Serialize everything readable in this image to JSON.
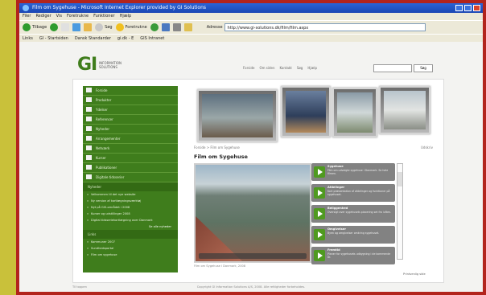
{
  "window": {
    "title": "Film om Sygehuse - Microsoft Internet Explorer provided by GI Solutions"
  },
  "menubar": [
    "Filer",
    "Rediger",
    "Vis",
    "Foretrukne",
    "Funktioner",
    "Hjælp"
  ],
  "toolbar": {
    "back_label": "Tilbage",
    "search_label": "Søg",
    "favorites_label": "Foretrukne",
    "address_label": "Adresse",
    "address_value": "http://www.gi-solutions.dk/film/film.aspx"
  },
  "links": [
    "Links",
    "GI - Startsiden",
    "Dansk Standarder",
    "gi.dk - E",
    "GIS Intranet"
  ],
  "site": {
    "logo_text": "GI",
    "logo_sub": "INFORMATION SOLUTIONS",
    "topnav": [
      "Forside",
      "Om siden",
      "Kontakt",
      "Søg",
      "Hjælp"
    ],
    "search_button": "Søg"
  },
  "sidebar": {
    "items": [
      "Forside",
      "Produkter",
      "Ydelser",
      "Referencer",
      "Nyheder",
      "Arrangementer",
      "Netværk",
      "Kurser",
      "Publikationer",
      "Digitale tidsserier"
    ],
    "section_title": "Nyheder",
    "links": [
      "Velkommen til det nye website",
      "Ny version af kortlægningsværktøj",
      "Nyt på GIS-området i 2008",
      "Kurser og udstillinger 2008",
      "Digital tidsseriekortlægning over Danmark"
    ],
    "more_link": "Se alle nyheder",
    "section2_title": "Links",
    "links2": [
      "Kommuner 2007",
      "Sundhedsportal",
      "Film om sygehuse"
    ]
  },
  "main": {
    "breadcrumb": "Forside > Film om Sygehuse",
    "utvid": "Udskriv",
    "heading": "Film om Sygehuse",
    "caption": "Film om Sygehuse i Danmark, 2008",
    "print": "Printvenlig side"
  },
  "videos": [
    {
      "title": "Sygehuse",
      "desc": "Film om udvalgte sygehuse i Danmark. Se hele filmen."
    },
    {
      "title": "Afdelinger",
      "desc": "Kort præsentation af afdelinger og funktioner på sygehuset."
    },
    {
      "title": "Beliggenhed",
      "desc": "Oversigt over sygehusets placering set fra luften."
    },
    {
      "title": "Omgivelser",
      "desc": "Byen og omgivelser omkring sygehuset."
    },
    {
      "title": "Fremtid",
      "desc": "Planer for sygehusets udbygning i de kommende år."
    }
  ],
  "footer": {
    "left": "Til toppen",
    "center": "Copyright GI Information Solutions A/S, 2008. Alle rettigheder forbeholdes."
  },
  "colors": {
    "sidebar_green": "#3f7d1c",
    "logo_green": "#3f7d1c",
    "frame_yellow": "#c9c13a",
    "frame_red": "#b2241d"
  }
}
